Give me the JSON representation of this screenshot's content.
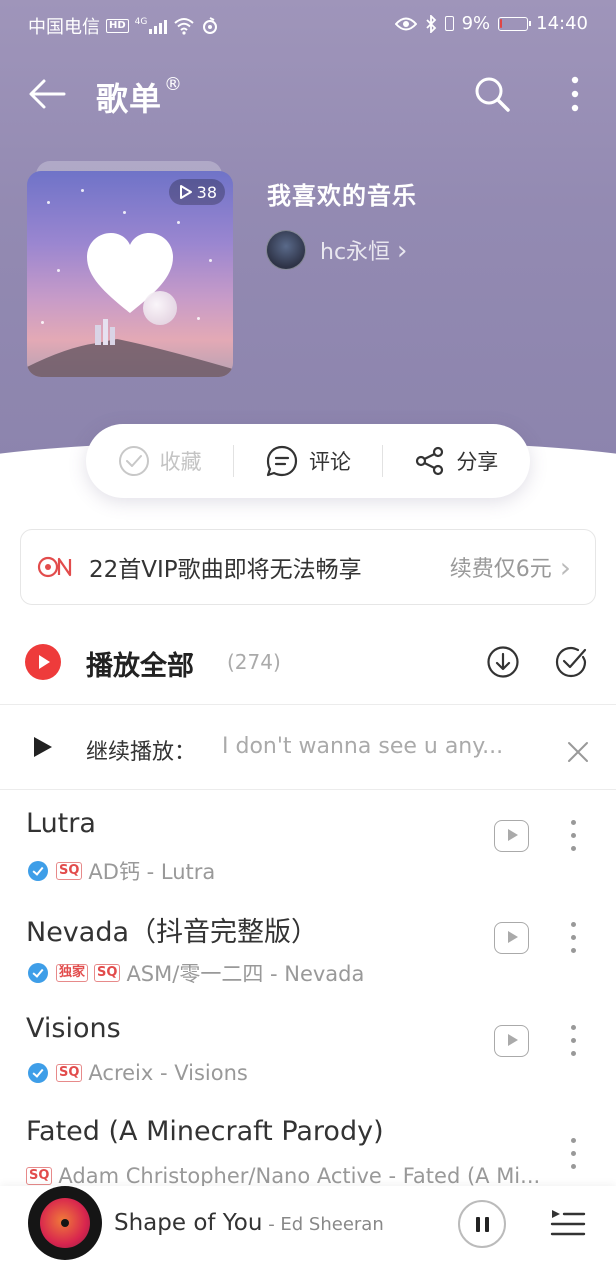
{
  "status_bar": {
    "carrier": "中国电信",
    "hd": "HD",
    "network": "4G",
    "battery": "9%",
    "battery_level": 0.09,
    "time": "14:40"
  },
  "nav": {
    "title": "歌单",
    "title_mark": "®"
  },
  "playlist": {
    "play_count": "38",
    "name": "我喜欢的音乐",
    "creator": "hc永恒",
    "creator_chevron": "›"
  },
  "actions": {
    "collect": "收藏",
    "comment": "评论",
    "share": "分享"
  },
  "vip_banner": {
    "text": "22首VIP歌曲即将无法畅享",
    "renew": "续费仅6元",
    "chevron": "›"
  },
  "play_all": {
    "label": "播放全部",
    "count": "(274)"
  },
  "continue": {
    "label": "继续播放：",
    "song": "I don't wanna see u any..."
  },
  "songs": [
    {
      "title": "Lutra",
      "verified": true,
      "tags": [
        "SQ"
      ],
      "meta": "AD钙 - Lutra"
    },
    {
      "title": "Nevada（抖音完整版）",
      "verified": true,
      "tags": [
        "独家",
        "SQ"
      ],
      "meta": "ASM/零一二四 - Nevada"
    },
    {
      "title": "Visions",
      "verified": true,
      "tags": [
        "SQ"
      ],
      "meta": "Acreix - Visions"
    },
    {
      "title": "Fated (A Minecraft Parody)",
      "verified": false,
      "tags": [
        "SQ"
      ],
      "meta": "Adam Christopher/Nano Active - Fated (A Mi..."
    }
  ],
  "mini_player": {
    "title": "Shape of You",
    "artist": " - Ed Sheeran"
  },
  "colors": {
    "header": "#938ab2",
    "accent_red": "#ee3b3b",
    "verified_blue": "#3e9ee8"
  },
  "icons": [
    "back-arrow-icon",
    "search-icon",
    "more-vertical-icon",
    "play-icon",
    "heart-icon",
    "check-circle-icon",
    "comment-icon",
    "share-icon",
    "vip-logo-icon",
    "chevron-right-icon",
    "play-all-icon",
    "download-icon",
    "multi-select-icon",
    "close-icon",
    "song-play-icon",
    "pause-icon",
    "playlist-queue-icon"
  ]
}
